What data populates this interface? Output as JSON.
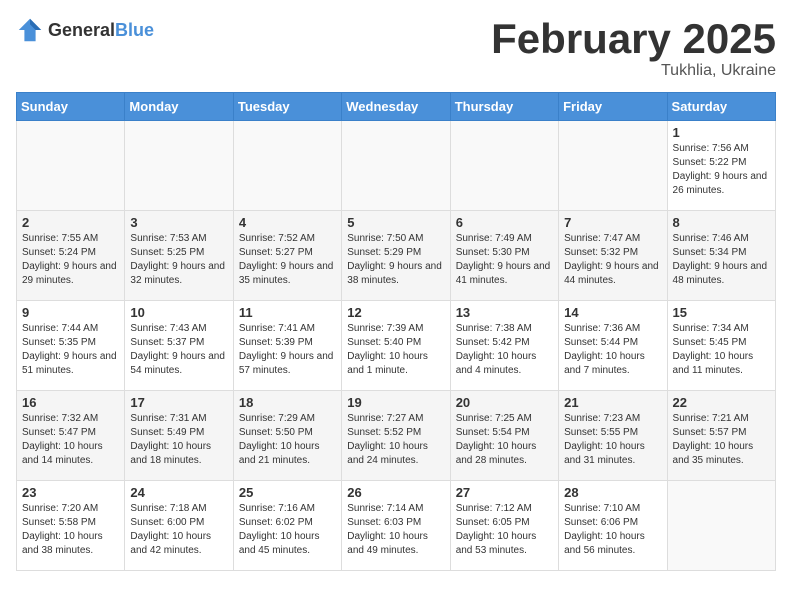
{
  "logo": {
    "general": "General",
    "blue": "Blue"
  },
  "header": {
    "month": "February 2025",
    "location": "Tukhlia, Ukraine"
  },
  "weekdays": [
    "Sunday",
    "Monday",
    "Tuesday",
    "Wednesday",
    "Thursday",
    "Friday",
    "Saturday"
  ],
  "weeks": [
    [
      null,
      null,
      null,
      null,
      null,
      null,
      {
        "day": "1",
        "sunrise": "7:56 AM",
        "sunset": "5:22 PM",
        "daylight": "9 hours and 26 minutes."
      }
    ],
    [
      {
        "day": "2",
        "sunrise": "7:55 AM",
        "sunset": "5:24 PM",
        "daylight": "9 hours and 29 minutes."
      },
      {
        "day": "3",
        "sunrise": "7:53 AM",
        "sunset": "5:25 PM",
        "daylight": "9 hours and 32 minutes."
      },
      {
        "day": "4",
        "sunrise": "7:52 AM",
        "sunset": "5:27 PM",
        "daylight": "9 hours and 35 minutes."
      },
      {
        "day": "5",
        "sunrise": "7:50 AM",
        "sunset": "5:29 PM",
        "daylight": "9 hours and 38 minutes."
      },
      {
        "day": "6",
        "sunrise": "7:49 AM",
        "sunset": "5:30 PM",
        "daylight": "9 hours and 41 minutes."
      },
      {
        "day": "7",
        "sunrise": "7:47 AM",
        "sunset": "5:32 PM",
        "daylight": "9 hours and 44 minutes."
      },
      {
        "day": "8",
        "sunrise": "7:46 AM",
        "sunset": "5:34 PM",
        "daylight": "9 hours and 48 minutes."
      }
    ],
    [
      {
        "day": "9",
        "sunrise": "7:44 AM",
        "sunset": "5:35 PM",
        "daylight": "9 hours and 51 minutes."
      },
      {
        "day": "10",
        "sunrise": "7:43 AM",
        "sunset": "5:37 PM",
        "daylight": "9 hours and 54 minutes."
      },
      {
        "day": "11",
        "sunrise": "7:41 AM",
        "sunset": "5:39 PM",
        "daylight": "9 hours and 57 minutes."
      },
      {
        "day": "12",
        "sunrise": "7:39 AM",
        "sunset": "5:40 PM",
        "daylight": "10 hours and 1 minute."
      },
      {
        "day": "13",
        "sunrise": "7:38 AM",
        "sunset": "5:42 PM",
        "daylight": "10 hours and 4 minutes."
      },
      {
        "day": "14",
        "sunrise": "7:36 AM",
        "sunset": "5:44 PM",
        "daylight": "10 hours and 7 minutes."
      },
      {
        "day": "15",
        "sunrise": "7:34 AM",
        "sunset": "5:45 PM",
        "daylight": "10 hours and 11 minutes."
      }
    ],
    [
      {
        "day": "16",
        "sunrise": "7:32 AM",
        "sunset": "5:47 PM",
        "daylight": "10 hours and 14 minutes."
      },
      {
        "day": "17",
        "sunrise": "7:31 AM",
        "sunset": "5:49 PM",
        "daylight": "10 hours and 18 minutes."
      },
      {
        "day": "18",
        "sunrise": "7:29 AM",
        "sunset": "5:50 PM",
        "daylight": "10 hours and 21 minutes."
      },
      {
        "day": "19",
        "sunrise": "7:27 AM",
        "sunset": "5:52 PM",
        "daylight": "10 hours and 24 minutes."
      },
      {
        "day": "20",
        "sunrise": "7:25 AM",
        "sunset": "5:54 PM",
        "daylight": "10 hours and 28 minutes."
      },
      {
        "day": "21",
        "sunrise": "7:23 AM",
        "sunset": "5:55 PM",
        "daylight": "10 hours and 31 minutes."
      },
      {
        "day": "22",
        "sunrise": "7:21 AM",
        "sunset": "5:57 PM",
        "daylight": "10 hours and 35 minutes."
      }
    ],
    [
      {
        "day": "23",
        "sunrise": "7:20 AM",
        "sunset": "5:58 PM",
        "daylight": "10 hours and 38 minutes."
      },
      {
        "day": "24",
        "sunrise": "7:18 AM",
        "sunset": "6:00 PM",
        "daylight": "10 hours and 42 minutes."
      },
      {
        "day": "25",
        "sunrise": "7:16 AM",
        "sunset": "6:02 PM",
        "daylight": "10 hours and 45 minutes."
      },
      {
        "day": "26",
        "sunrise": "7:14 AM",
        "sunset": "6:03 PM",
        "daylight": "10 hours and 49 minutes."
      },
      {
        "day": "27",
        "sunrise": "7:12 AM",
        "sunset": "6:05 PM",
        "daylight": "10 hours and 53 minutes."
      },
      {
        "day": "28",
        "sunrise": "7:10 AM",
        "sunset": "6:06 PM",
        "daylight": "10 hours and 56 minutes."
      },
      null
    ]
  ]
}
